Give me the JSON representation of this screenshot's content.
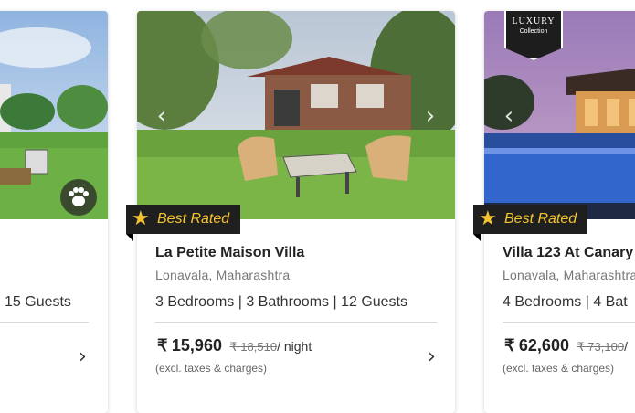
{
  "cards": [
    {
      "guests_tail": "15 Guests",
      "chevron_icon": "chevron-right-icon",
      "paw_icon": "paw-icon"
    },
    {
      "title": "La Petite Maison Villa",
      "location": "Lonavala, Maharashtra",
      "features": "3 Bedrooms | 3 Bathrooms | 12 Guests",
      "badge": "Best Rated",
      "price_currency": "₹",
      "price": "15,960",
      "old_price": "₹ 18,510",
      "price_unit": "/ night",
      "note": "(excl. taxes & charges)",
      "prev_icon": "chevron-left-icon",
      "next_icon": "chevron-right-icon"
    },
    {
      "title": "Villa 123 At Canary",
      "location": "Lonavala, Maharashtra",
      "features": "4 Bedrooms | 4 Bat",
      "badge": "Best Rated",
      "price_currency": "₹",
      "price": "62,600",
      "old_price": "₹ 73,100",
      "price_unit": "/",
      "note": "(excl. taxes & charges)",
      "luxury_line1": "LUXURY",
      "luxury_line2": "Collection"
    }
  ],
  "colors": {
    "badge_bg": "#1f1f1f",
    "badge_text": "#f4c430",
    "divider": "#d9d9d9"
  }
}
